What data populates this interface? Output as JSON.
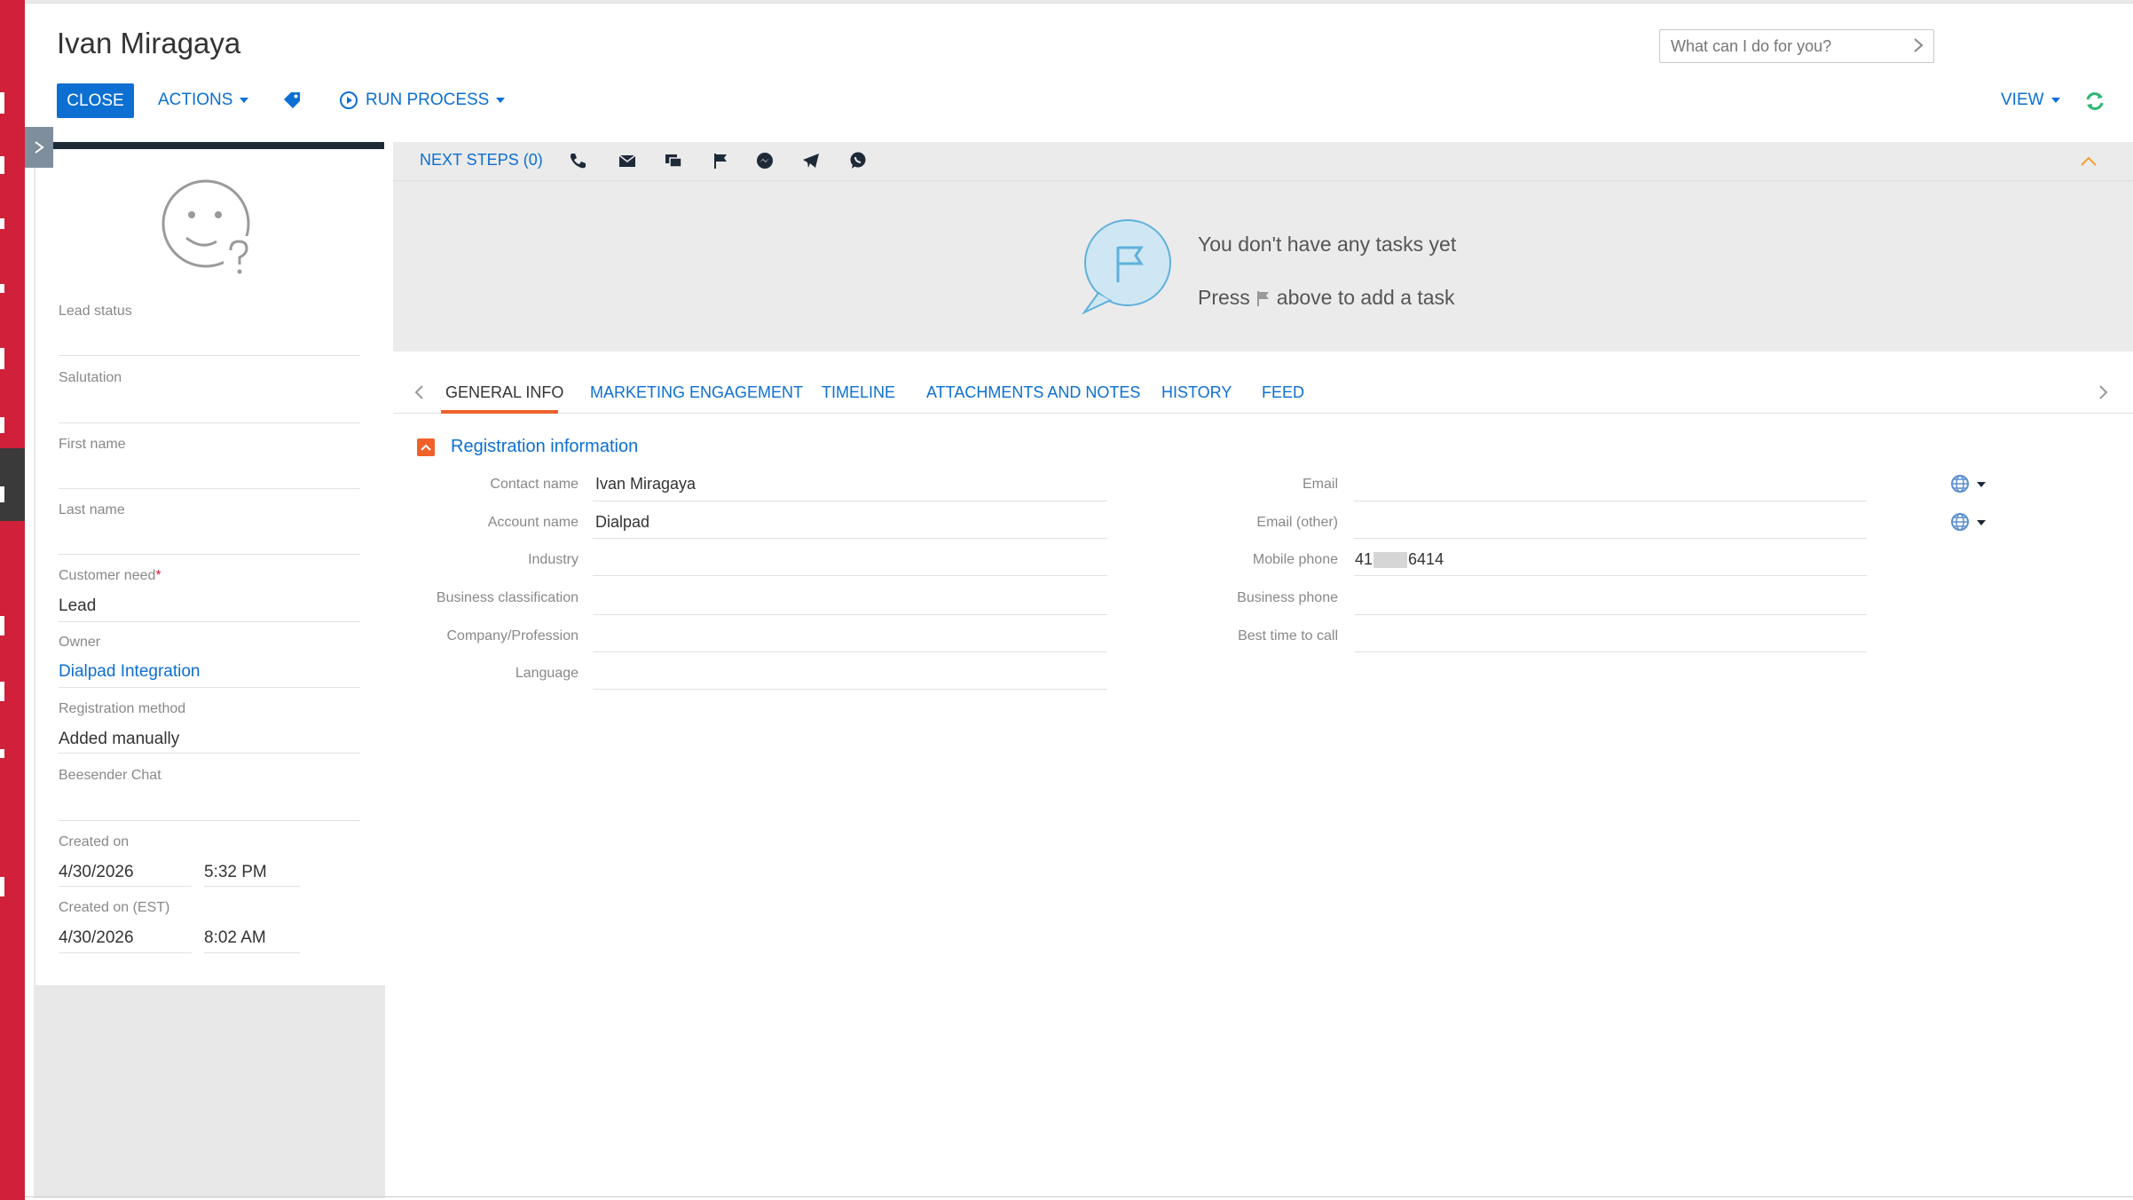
{
  "header": {
    "title": "Ivan Miragaya",
    "search_placeholder": "What can I do for you?",
    "close_label": "CLOSE",
    "actions_label": "ACTIONS",
    "run_process_label": "RUN PROCESS",
    "view_label": "VIEW"
  },
  "profile": {
    "fields": {
      "lead_status": {
        "label": "Lead status",
        "value": ""
      },
      "salutation": {
        "label": "Salutation",
        "value": ""
      },
      "first_name": {
        "label": "First name",
        "value": ""
      },
      "last_name": {
        "label": "Last name",
        "value": ""
      },
      "customer_need": {
        "label": "Customer need",
        "required_mark": "*",
        "value": "Lead"
      },
      "owner": {
        "label": "Owner",
        "value": "Dialpad Integration"
      },
      "registration_method": {
        "label": "Registration method",
        "value": "Added manually"
      },
      "beesender_chat": {
        "label": "Beesender Chat",
        "value": ""
      },
      "created_on": {
        "label": "Created on",
        "date": "4/30/2026",
        "time": "5:32 PM"
      },
      "created_on_est": {
        "label": "Created on (EST)",
        "date": "4/30/2026",
        "time": "8:02 AM"
      }
    }
  },
  "next_steps": {
    "title": "NEXT STEPS (0)",
    "icons": [
      "phone-icon",
      "email-icon",
      "chat-icon",
      "flag-icon",
      "messenger-icon",
      "telegram-icon",
      "whatsapp-icon"
    ],
    "empty_title": "You don't have any tasks yet",
    "empty_hint_before": "Press",
    "empty_hint_after": "above to add a task"
  },
  "tabs": [
    {
      "label": "GENERAL INFO",
      "active": true
    },
    {
      "label": "MARKETING ENGAGEMENT",
      "active": false
    },
    {
      "label": "TIMELINE",
      "active": false
    },
    {
      "label": "ATTACHMENTS AND NOTES",
      "active": false
    },
    {
      "label": "HISTORY",
      "active": false
    },
    {
      "label": "FEED",
      "active": false
    }
  ],
  "registration": {
    "title": "Registration information",
    "left_fields": [
      {
        "label": "Contact name",
        "value": "Ivan Miragaya"
      },
      {
        "label": "Account name",
        "value": "Dialpad"
      },
      {
        "label": "Industry",
        "value": ""
      },
      {
        "label": "Business classification",
        "value": ""
      },
      {
        "label": "Company/Profession",
        "value": ""
      },
      {
        "label": "Language",
        "value": ""
      }
    ],
    "right_fields": [
      {
        "label": "Email",
        "value": ""
      },
      {
        "label": "Email (other)",
        "value": ""
      },
      {
        "label": "Mobile phone",
        "value_prefix": "41",
        "value_suffix": "6414"
      },
      {
        "label": "Business phone",
        "value": ""
      },
      {
        "label": "Best time to call",
        "value": ""
      }
    ]
  },
  "colors": {
    "brand_red": "#d0203a",
    "primary_blue": "#0c6fd1",
    "accent_orange": "#f0612a",
    "refresh_green": "#2bb673"
  }
}
